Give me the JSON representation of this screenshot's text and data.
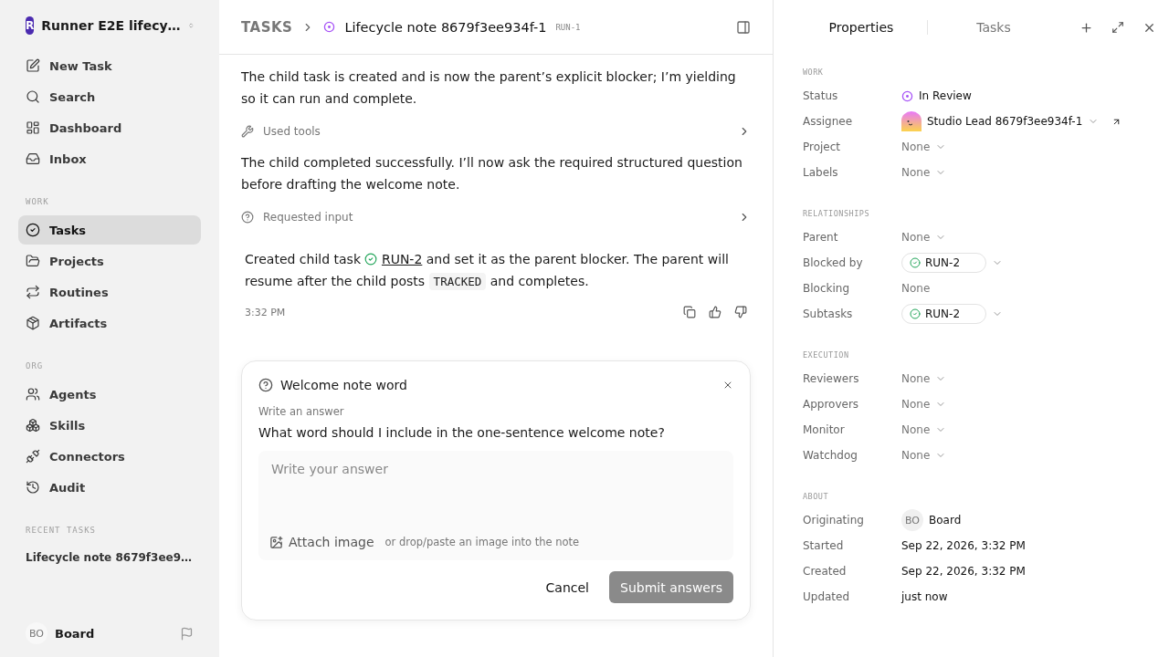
{
  "sidebar": {
    "workspace": {
      "initial": "R",
      "name": "Runner E2E lifecy…"
    },
    "sections": [
      {
        "items": [
          {
            "label": "New Task",
            "selected": false
          },
          {
            "label": "Search",
            "selected": false
          },
          {
            "label": "Dashboard",
            "selected": false
          },
          {
            "label": "Inbox",
            "selected": false
          }
        ]
      },
      {
        "title": "WORK",
        "items": [
          {
            "label": "Tasks",
            "selected": true
          },
          {
            "label": "Projects",
            "selected": false
          },
          {
            "label": "Routines",
            "selected": false
          },
          {
            "label": "Artifacts",
            "selected": false
          }
        ]
      },
      {
        "title": "ORG",
        "items": [
          {
            "label": "Agents",
            "selected": false
          },
          {
            "label": "Skills",
            "selected": false
          },
          {
            "label": "Connectors",
            "selected": false
          },
          {
            "label": "Audit",
            "selected": false
          }
        ]
      }
    ],
    "recent": {
      "title": "RECENT TASKS",
      "items": [
        "Lifecycle note 8679f3ee9…"
      ]
    },
    "user": {
      "initials": "BO",
      "name": "Board"
    }
  },
  "header": {
    "root": "TASKS",
    "title": "Lifecycle note 8679f3ee934f-1",
    "id": "RUN-1"
  },
  "feed": [
    {
      "kind": "text",
      "text": "The child task is created and is now the parent’s explicit blocker; I’m yielding so it can run and complete."
    },
    {
      "kind": "step",
      "label": "Used tools"
    },
    {
      "kind": "text",
      "text": "The child completed successfully. I’ll now ask the required structured question before drafting the welcome note."
    },
    {
      "kind": "step",
      "label": "Requested input"
    },
    {
      "kind": "result",
      "before": "Created child task",
      "link": "RUN-2",
      "middle": "and set it as the parent blocker. The parent will resume after the child posts",
      "code": "TRACKED",
      "after": "and completes.",
      "time": "3:32 PM"
    }
  ],
  "question": {
    "title": "Welcome note word",
    "hint": "Write an answer",
    "question": "What word should I include in the one-sentence welcome note?",
    "placeholder": "Write your answer",
    "attach": "Attach image",
    "attach_hint": "or drop/paste an image into the note",
    "cancel": "Cancel",
    "submit": {
      "label": "Submit answers",
      "disabled": true
    }
  },
  "panel": {
    "tabs": [
      {
        "label": "Properties",
        "selected": true
      },
      {
        "label": "Tasks",
        "selected": false
      }
    ],
    "sections": [
      {
        "title": "WORK",
        "rows": [
          {
            "label": "Status",
            "kind": "status",
            "value": "In Review",
            "color": "#a855f7"
          },
          {
            "label": "Assignee",
            "kind": "person",
            "value": "Studio Lead 8679f3ee934f-1"
          },
          {
            "label": "Project",
            "kind": "select",
            "value": "None"
          },
          {
            "label": "Labels",
            "kind": "select",
            "value": "None"
          }
        ]
      },
      {
        "title": "RELATIONSHIPS",
        "rows": [
          {
            "label": "Parent",
            "kind": "select",
            "value": "None"
          },
          {
            "label": "Blocked by",
            "kind": "chip",
            "value": "RUN-2"
          },
          {
            "label": "Blocking",
            "kind": "plain",
            "value": "None"
          },
          {
            "label": "Subtasks",
            "kind": "chip",
            "value": "RUN-2"
          }
        ]
      },
      {
        "title": "EXECUTION",
        "rows": [
          {
            "label": "Reviewers",
            "kind": "select",
            "value": "None"
          },
          {
            "label": "Approvers",
            "kind": "select",
            "value": "None"
          },
          {
            "label": "Monitor",
            "kind": "select",
            "value": "None"
          },
          {
            "label": "Watchdog",
            "kind": "select",
            "value": "None"
          }
        ]
      },
      {
        "title": "ABOUT",
        "rows": [
          {
            "label": "Originating",
            "kind": "initials",
            "initials": "BO",
            "value": "Board"
          },
          {
            "label": "Started",
            "kind": "date",
            "value": "Sep 22, 2026, 3:32 PM"
          },
          {
            "label": "Created",
            "kind": "date",
            "value": "Sep 22, 2026, 3:32 PM"
          },
          {
            "label": "Updated",
            "kind": "date",
            "value": "just now"
          }
        ]
      }
    ]
  }
}
